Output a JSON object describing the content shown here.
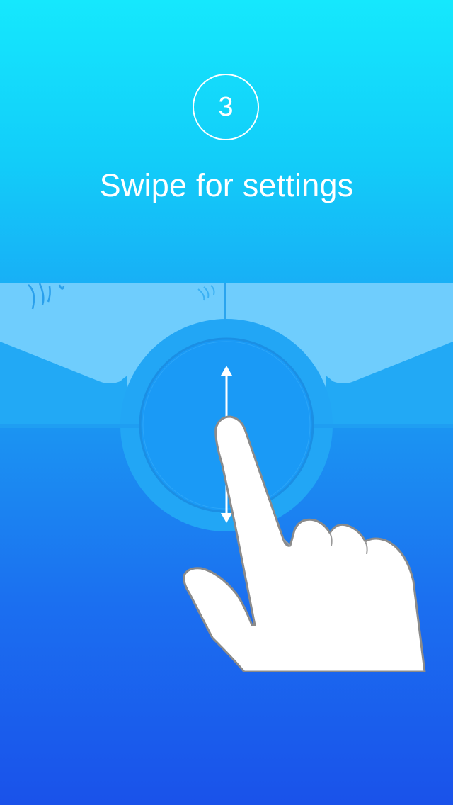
{
  "onboarding": {
    "step_number": "3",
    "headline": "Swipe for settings"
  },
  "colors": {
    "background_top": "#15e8fd",
    "background_bottom": "#1a52ea",
    "panel_light": "#6fcdfd",
    "panel_mid": "#22a9f5",
    "dial": "#1a9af6",
    "text": "#ffffff"
  },
  "icons": [
    "weather-icon-partial",
    "wifi-signal-icon",
    "vertical-swipe-arrow-icon",
    "pointing-hand-icon"
  ]
}
